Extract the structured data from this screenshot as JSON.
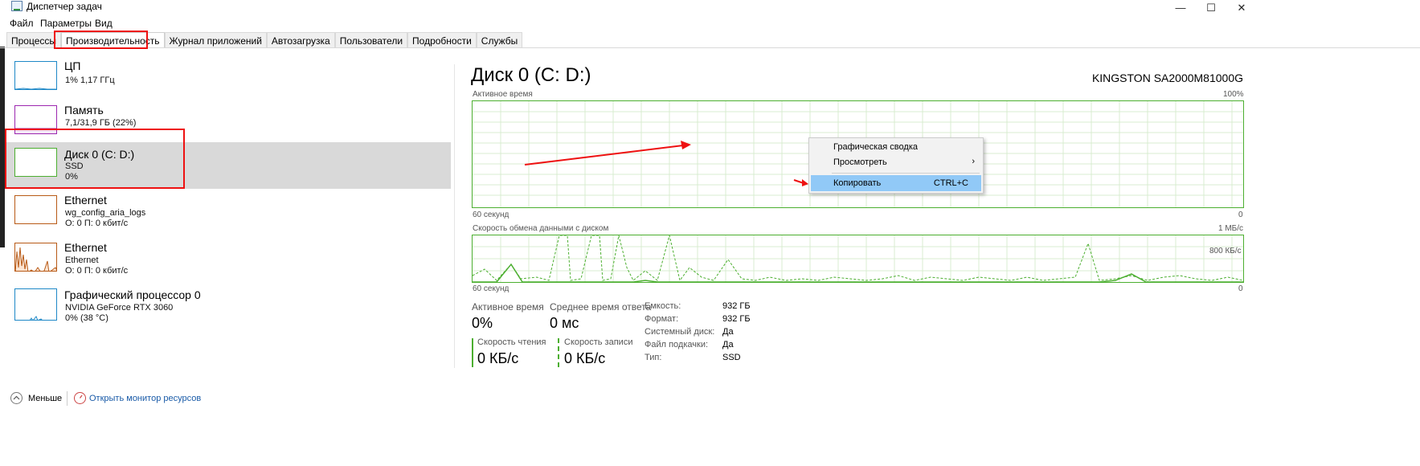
{
  "window": {
    "title": "Диспетчер задач"
  },
  "menu": [
    "Файл",
    "Параметры",
    "Вид"
  ],
  "tabs": [
    "Процессы",
    "Производительность",
    "Журнал приложений",
    "Автозагрузка",
    "Пользователи",
    "Подробности",
    "Службы"
  ],
  "sidebar": [
    {
      "title": "ЦП",
      "line1": "1% 1,17 ГГц",
      "line2": "",
      "color": "#1e88c7"
    },
    {
      "title": "Память",
      "line1": "7,1/31,9 ГБ (22%)",
      "line2": "",
      "color": "#9c27b0"
    },
    {
      "title": "Диск 0 (C: D:)",
      "line1": "SSD",
      "line2": "0%",
      "color": "#4caf30"
    },
    {
      "title": "Ethernet",
      "line1": "wg_config_aria_logs",
      "line2": "О: 0 П: 0 кбит/с",
      "color": "#b85a16"
    },
    {
      "title": "Ethernet",
      "line1": "Ethernet",
      "line2": "О: 0 П: 0 кбит/с",
      "color": "#b85a16"
    },
    {
      "title": "Графический процессор 0",
      "line1": "NVIDIA GeForce RTX 3060",
      "line2": "0% (38 °C)",
      "color": "#1e88c7"
    }
  ],
  "main": {
    "title": "Диск 0 (C: D:)",
    "model": "KINGSTON SA2000M81000G",
    "graph1": {
      "label": "Активное время",
      "max": "100%",
      "time": "60 секунд",
      "min": "0"
    },
    "graph2": {
      "label": "Скорость обмена данными с диском",
      "max": "1 МБ/с",
      "mid": "800 КБ/с",
      "time": "60 секунд",
      "min": "0"
    },
    "metrics": {
      "active_label": "Активное время",
      "active_value": "0%",
      "resp_label": "Среднее время ответа",
      "resp_value": "0 мс",
      "read_label": "Скорость чтения",
      "read_value": "0 КБ/с",
      "write_label": "Скорость записи",
      "write_value": "0 КБ/с"
    },
    "props": [
      {
        "label": "Емкость:",
        "value": "932 ГБ"
      },
      {
        "label": "Формат:",
        "value": "932 ГБ"
      },
      {
        "label": "Системный диск:",
        "value": "Да"
      },
      {
        "label": "Файл подкачки:",
        "value": "Да"
      },
      {
        "label": "Тип:",
        "value": "SSD"
      }
    ]
  },
  "context_menu": {
    "items": [
      {
        "label": "Графическая сводка",
        "shortcut": ""
      },
      {
        "label": "Просмотреть",
        "shortcut": ""
      },
      {
        "label": "Копировать",
        "shortcut": "CTRL+C"
      }
    ]
  },
  "footer": {
    "less": "Меньше",
    "monitor": "Открыть монитор ресурсов"
  },
  "colors": {
    "accent_green": "#4caf30",
    "annotation_red": "#e11111",
    "menu_hover": "#91c9f7"
  },
  "icons": [
    "app-icon",
    "minimize-icon",
    "maximize-icon",
    "close-icon",
    "chevron-right-icon",
    "chevron-up-icon",
    "resource-monitor-icon"
  ]
}
